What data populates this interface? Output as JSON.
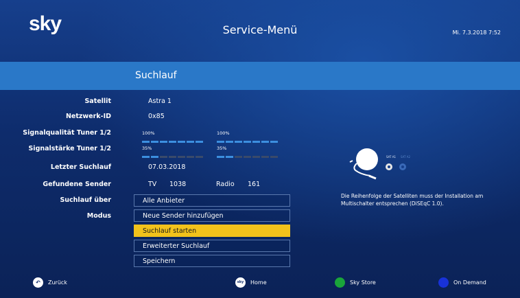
{
  "header": {
    "logo": "sky",
    "title": "Service-Menü",
    "datetime": "Mi. 7.3.2018  7:52"
  },
  "section": {
    "title": "Suchlauf"
  },
  "rows": {
    "satellite": {
      "label": "Satellit",
      "value": "Astra 1"
    },
    "network_id": {
      "label": "Netzwerk-ID",
      "value": "0x85"
    },
    "signal_quality": {
      "label": "Signalqualität Tuner 1/2",
      "tuner1": "100%",
      "tuner2": "100%",
      "tuner1_level": 1.0,
      "tuner2_level": 1.0
    },
    "signal_strength": {
      "label": "Signalstärke Tuner 1/2",
      "tuner1": "35%",
      "tuner2": "35%",
      "tuner1_level": 0.35,
      "tuner2_level": 0.35
    },
    "last_scan": {
      "label": "Letzter Suchlauf",
      "value": "07.03.2018"
    },
    "found_channels": {
      "label": "Gefundene Sender",
      "tv_label": "TV",
      "tv_count": "1038",
      "radio_label": "Radio",
      "radio_count": "161"
    },
    "scan_via": {
      "label": "Suchlauf über"
    },
    "mode": {
      "label": "Modus"
    }
  },
  "menu": {
    "items": [
      {
        "label": "Alle Anbieter"
      },
      {
        "label": "Neue Sender hinzufügen"
      },
      {
        "label": "Suchlauf starten"
      },
      {
        "label": "Erweiterter Suchlauf"
      },
      {
        "label": "Speichern"
      }
    ],
    "selected_index": 2
  },
  "info": {
    "text": "Die Reihenfolge der Satelliten muss der Installation am Multischalter entsprechen (DiSEqC 1.0).",
    "sat1_label": "SAT A1",
    "sat2_label": "SAT A2"
  },
  "footer": {
    "back": "Zurück",
    "home": "Home",
    "store": "Sky Store",
    "on_demand": "On Demand",
    "home_glyph": "sky"
  },
  "colors": {
    "background": "#0f2e6e",
    "section_bar": "#2a78c8",
    "selected": "#f2c21b",
    "green_button": "#1aa53a",
    "blue_button": "#1832d8"
  }
}
